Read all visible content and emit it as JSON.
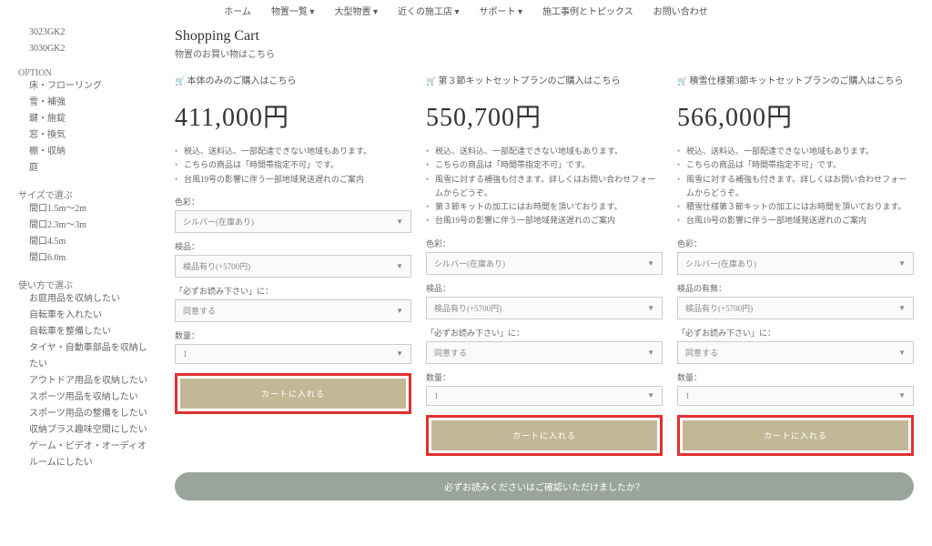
{
  "nav": [
    "ホーム",
    "物置一覧  ▾",
    "大型物置  ▾",
    "近くの施工店  ▾",
    "サポート  ▾",
    "施工事例とトピックス",
    "お問い合わせ"
  ],
  "sidebar": {
    "models": [
      "3023GK2",
      "3030GK2"
    ],
    "option_head": "OPTION",
    "options": [
      "床・フローリング",
      "雪・補強",
      "鍵・施錠",
      "窓・換気",
      "棚・収納",
      "庭"
    ],
    "size_head": "サイズで選ぶ",
    "sizes": [
      "間口1.5m～2m",
      "間口2.3m～3m",
      "間口4.5m",
      "間口6.0m"
    ],
    "use_head": "使い方で選ぶ",
    "uses": [
      "お庭用品を収納したい",
      "自転車を入れたい",
      "自転車を整備したい",
      "タイヤ・自動車部品を収納したい",
      "アウトドア用品を収納したい",
      "スポーツ用品を収納したい",
      "スポーツ用品の整備をしたい",
      "収納プラス趣味空間にしたい",
      "ゲーム・ビデオ・オーディオルームにしたい"
    ]
  },
  "cart": {
    "title": "Shopping Cart",
    "sub": "物置のお買い物はこちら"
  },
  "cols": [
    {
      "head": "本体のみのご購入はこちら",
      "price": "411,000円",
      "bullets": [
        "税込、送料込、一部配達できない地域もあります。",
        "こちらの商品は「時間帯指定不可」です。",
        "台風19号の影響に伴う一部地域発送遅れのご案内"
      ],
      "fields": [
        {
          "label": "色彩：",
          "value": "シルバー(在庫あり)"
        },
        {
          "label": "検品：",
          "value": "検品有り(+5700円)"
        },
        {
          "label": "「必ずお読み下さい」に：",
          "value": "同意する"
        },
        {
          "label": "数量：",
          "value": "1"
        }
      ],
      "btn": "カートに入れる"
    },
    {
      "head": "第３節キットセットプランのご購入はこちら",
      "price": "550,700円",
      "bullets": [
        "税込、送料込、一部配達できない地域もあります。",
        "こちらの商品は「時間帯指定不可」です。",
        "風雪に対する補強も付きます。詳しくはお問い合わせフォームからどうぞ。",
        "第３節キットの加工にはお時間を頂いております。",
        "台風19号の影響に伴う一部地域発送遅れのご案内"
      ],
      "fields": [
        {
          "label": "色彩：",
          "value": "シルバー(在庫あり)"
        },
        {
          "label": "検品：",
          "value": "検品有り(+5700円)"
        },
        {
          "label": "「必ずお読み下さい」に：",
          "value": "同意する"
        },
        {
          "label": "数量：",
          "value": "1"
        }
      ],
      "btn": "カートに入れる"
    },
    {
      "head": "積雪仕様第3節キットセットプランのご購入はこちら",
      "price": "566,000円",
      "bullets": [
        "税込、送料込、一部配達できない地域もあります。",
        "こちらの商品は「時間帯指定不可」です。",
        "風雪に対する補強も付きます。詳しくはお問い合わせフォームからどうぞ。",
        "積雪仕様第３節キットの加工にはお時間を頂いております。",
        "台風19号の影響に伴う一部地域発送遅れのご案内"
      ],
      "fields": [
        {
          "label": "色彩：",
          "value": "シルバー(在庫あり)"
        },
        {
          "label": "検品の有無：",
          "value": "検品有り(+5700円)"
        },
        {
          "label": "「必ずお読み下さい」に：",
          "value": "同意する"
        },
        {
          "label": "数量：",
          "value": "1"
        }
      ],
      "btn": "カートに入れる"
    }
  ],
  "banner": "必ずお読みくださいはご確認いただけましたか？"
}
